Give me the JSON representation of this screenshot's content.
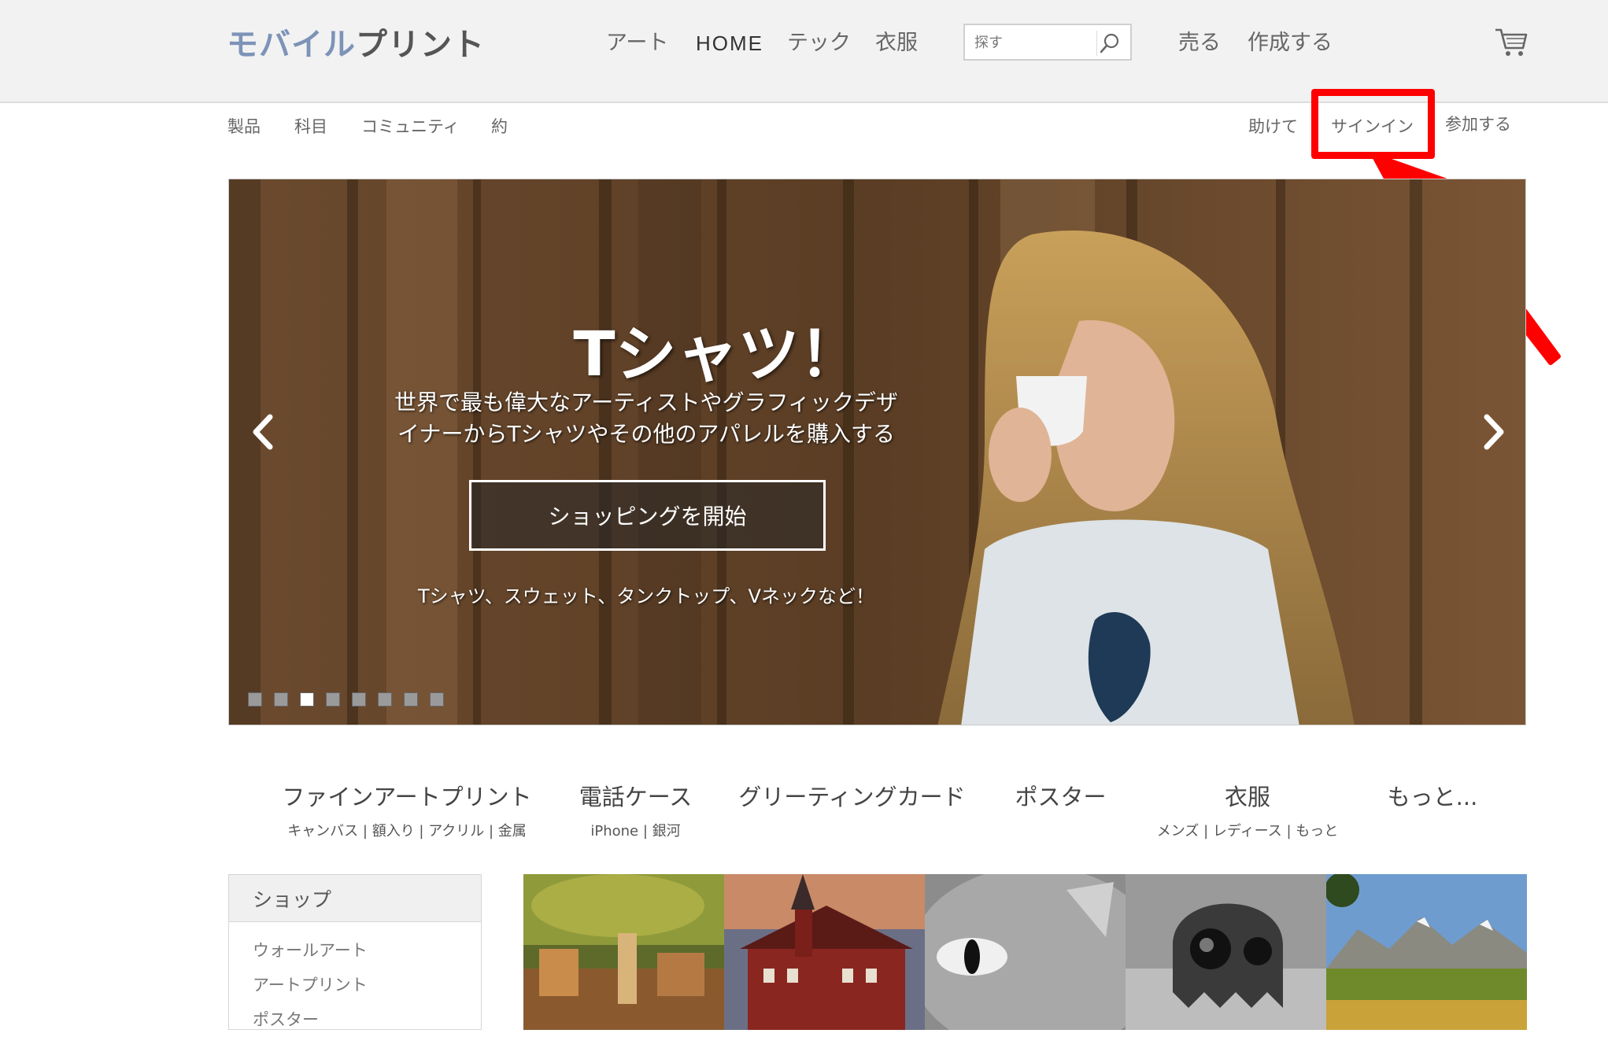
{
  "header": {
    "logo_part1": "モバイル",
    "logo_part2": "プリント",
    "nav": [
      "アート",
      "HOME",
      "テック",
      "衣服"
    ],
    "search_placeholder": "探す",
    "right_links": [
      "売る",
      "作成する"
    ]
  },
  "subnav": {
    "left": [
      "製品",
      "科目",
      "コミュニティ",
      "約"
    ],
    "help": "助けて",
    "signin": "サインイン",
    "join": "参加する"
  },
  "hero": {
    "title": "Tシャツ！",
    "subtitle": "世界で最も偉大なアーティストやグラフィックデザイナーからTシャツやその他のアパレルを購入する",
    "button": "ショッピングを開始",
    "note": "Tシャツ、スウェット、タンクトップ、Vネックなど！",
    "slide_count": 8,
    "active_slide": 3
  },
  "categories": [
    {
      "title": "ファインアートプリント",
      "sub": "キャンバス | 額入り | アクリル | 金属"
    },
    {
      "title": "電話ケース",
      "sub": "iPhone | 銀河"
    },
    {
      "title": "グリーティングカード",
      "sub": ""
    },
    {
      "title": "ポスター",
      "sub": ""
    },
    {
      "title": "衣服",
      "sub": "メンズ | レディース | もっと"
    },
    {
      "title": "もっと...",
      "sub": ""
    }
  ],
  "shop": {
    "heading": "ショップ",
    "items": [
      "ウォールアート",
      "アートプリント",
      "ポスター"
    ]
  },
  "colors": {
    "highlight": "#ff0000",
    "logo_accent": "#7d93b8"
  }
}
